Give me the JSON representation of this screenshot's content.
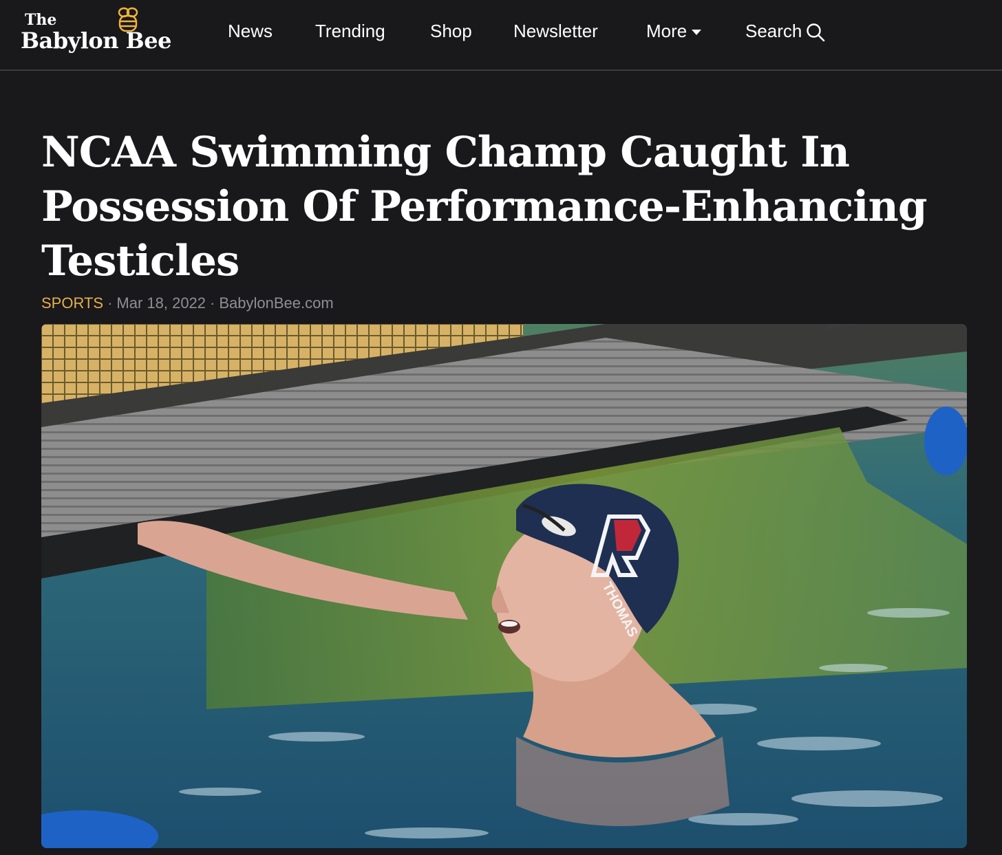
{
  "site": {
    "logo_top": "The",
    "logo_name": "Babylon Bee"
  },
  "nav": {
    "items": [
      "News",
      "Trending",
      "Shop",
      "Newsletter",
      "More"
    ],
    "search_label": "Search"
  },
  "article": {
    "headline_lines": [
      "NCAA Swimming Champ Caught In",
      "Possession Of Performance-Enhancing",
      "Testicles"
    ],
    "category": "SPORTS",
    "date": "Mar 18, 2022",
    "source": "BabylonBee.com",
    "image": {
      "cap_text": "THOMAS",
      "cap_letter": "P"
    }
  },
  "colors": {
    "background": "#19181b",
    "category_accent": "#e7b04b",
    "meta_gray": "#8f8f95"
  }
}
